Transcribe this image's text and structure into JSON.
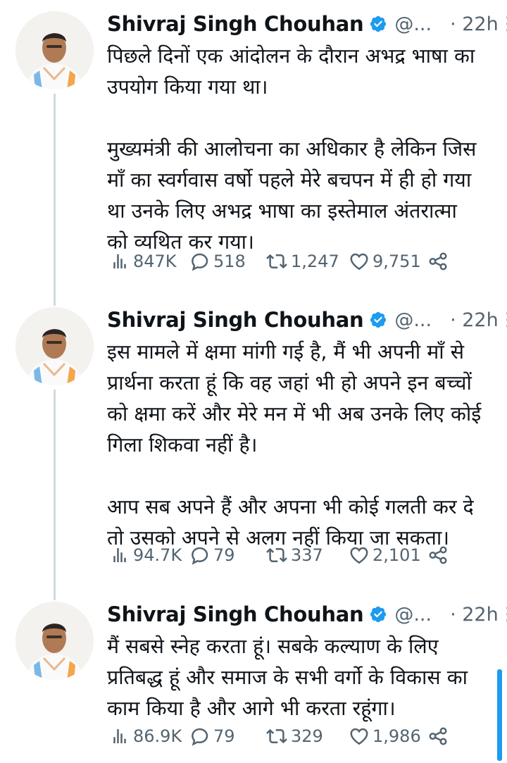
{
  "colors": {
    "verified": "#1d9bf0",
    "thread_line": "#cfd9de",
    "secondary_text": "#536471",
    "scrollbar": "#1d9bf0"
  },
  "tweets": [
    {
      "author": "Shivraj Singh Chouhan",
      "handle": "@...",
      "time": "· 22h",
      "text": "पिछले दिनों एक आंदोलन के दौरान अभद्र भाषा का\nउपयोग किया गया था।\n\nमुख्यमंत्री की आलोचना का अधिकार है लेकिन जिस\nमाँ का स्वर्गवास वर्षो पहले मेरे बचपन में ही हो गया\nथा उनके लिए अभद्र भाषा का इस्तेमाल अंतरात्मा\nको व्यथित कर गया।",
      "views": "847K",
      "replies": "518",
      "retweets": "1,247",
      "likes": "9,751"
    },
    {
      "author": "Shivraj Singh Chouhan",
      "handle": "@...",
      "time": "· 22h",
      "text": "इस मामले में क्षमा मांगी गई है, मैं भी अपनी माँ से\nप्रार्थना करता हूं कि वह जहां भी हो अपने इन बच्चों\nको क्षमा करें और मेरे मन में भी अब उनके लिए कोई\nगिला शिकवा नहीं है।\n\nआप सब अपने हैं और अपना भी कोई गलती कर दे\nतो उसको अपने से अलग नहीं किया जा सकता।",
      "views": "94.7K",
      "replies": "79",
      "retweets": "337",
      "likes": "2,101"
    },
    {
      "author": "Shivraj Singh Chouhan",
      "handle": "@...",
      "time": "· 22h",
      "text": "मैं सबसे स्नेह करता हूं। सबके कल्याण के लिए\nप्रतिबद्ध हूं और समाज के सभी वर्गो के विकास का\nकाम किया है और आगे भी करता रहूंगा।",
      "views": "86.9K",
      "replies": "79",
      "retweets": "329",
      "likes": "1,986"
    }
  ]
}
